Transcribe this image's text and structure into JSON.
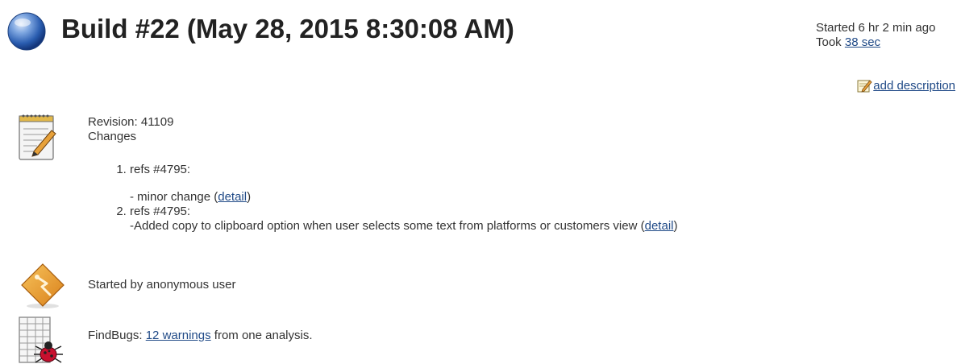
{
  "header": {
    "title": "Build #22 (May 28, 2015 8:30:08 AM)",
    "started_text": "Started 6 hr 2 min ago",
    "took_label": "Took",
    "duration_link": "38 sec"
  },
  "actions": {
    "add_description": "add description"
  },
  "changes": {
    "revision": "Revision: 41109",
    "heading": "Changes",
    "items": [
      {
        "title": "refs #4795:",
        "message": "- minor change",
        "link": "detail"
      },
      {
        "title": "refs #4795:",
        "message": "-Added copy to clipboard option when user selects some text from platforms or customers view",
        "link": "detail"
      }
    ]
  },
  "cause": {
    "text": "Started by anonymous user"
  },
  "findbugs": {
    "prefix": "FindBugs:",
    "warnings_link": "12 warnings",
    "suffix": "from one analysis."
  },
  "colors": {
    "link": "#204a87",
    "status_ball": "#2a5db0"
  },
  "icons": {
    "status": "blue-ball-icon",
    "changes": "notepad-icon",
    "cause": "user-diamond-icon",
    "findbugs": "findbugs-icon",
    "edit": "edit-icon"
  }
}
